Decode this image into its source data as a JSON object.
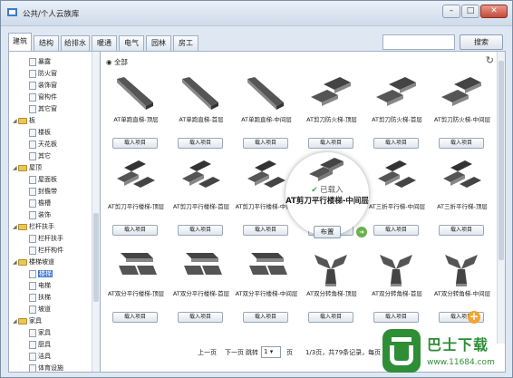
{
  "window": {
    "title": "公共/个人云族库",
    "min": "–",
    "max": "□",
    "close": "✕"
  },
  "tabs": [
    "建筑",
    "结构",
    "给排水",
    "暖通",
    "电气",
    "园林",
    "房工"
  ],
  "active_tab": 0,
  "search": {
    "value": "",
    "button": "搜索"
  },
  "tree": [
    {
      "label": "暴露",
      "level": 2,
      "icon": "doc"
    },
    {
      "label": "防火窗",
      "level": 2,
      "icon": "doc"
    },
    {
      "label": "装饰窗",
      "level": 2,
      "icon": "doc"
    },
    {
      "label": "窗构件",
      "level": 2,
      "icon": "doc"
    },
    {
      "label": "其它窗",
      "level": 2,
      "icon": "doc"
    },
    {
      "label": "板",
      "level": 1,
      "icon": "folder"
    },
    {
      "label": "楼板",
      "level": 2,
      "icon": "doc"
    },
    {
      "label": "天花板",
      "level": 2,
      "icon": "doc"
    },
    {
      "label": "其它",
      "level": 2,
      "icon": "doc"
    },
    {
      "label": "屋顶",
      "level": 1,
      "icon": "folder"
    },
    {
      "label": "屋面板",
      "level": 2,
      "icon": "doc"
    },
    {
      "label": "封檐带",
      "level": 2,
      "icon": "doc"
    },
    {
      "label": "檐槽",
      "level": 2,
      "icon": "doc"
    },
    {
      "label": "装饰",
      "level": 2,
      "icon": "doc"
    },
    {
      "label": "栏杆扶手",
      "level": 1,
      "icon": "folder"
    },
    {
      "label": "栏杆扶手",
      "level": 2,
      "icon": "doc"
    },
    {
      "label": "栏杆构件",
      "level": 2,
      "icon": "doc"
    },
    {
      "label": "楼梯坡道",
      "level": 1,
      "icon": "folder"
    },
    {
      "label": "楼梯",
      "level": 2,
      "icon": "doc",
      "selected": true
    },
    {
      "label": "电梯",
      "level": 2,
      "icon": "doc"
    },
    {
      "label": "扶梯",
      "level": 2,
      "icon": "doc"
    },
    {
      "label": "坡道",
      "level": 2,
      "icon": "doc"
    },
    {
      "label": "家具",
      "level": 1,
      "icon": "folder"
    },
    {
      "label": "家具",
      "level": 2,
      "icon": "doc"
    },
    {
      "label": "厨具",
      "level": 2,
      "icon": "doc"
    },
    {
      "label": "洁具",
      "level": 2,
      "icon": "doc"
    },
    {
      "label": "体育设施",
      "level": 2,
      "icon": "doc"
    }
  ],
  "scope_label": "全部",
  "load_label": "载入项目",
  "items": [
    {
      "name": "AT单跑直梯-顶层",
      "shape": "straight"
    },
    {
      "name": "AT单跑直梯-首层",
      "shape": "straight"
    },
    {
      "name": "AT单跑直梯-中间层",
      "shape": "straight"
    },
    {
      "name": "AT剪刀防火梯-顶层",
      "shape": "scissor"
    },
    {
      "name": "AT剪刀防火梯-首层",
      "shape": "scissor"
    },
    {
      "name": "AT剪刀防火梯-中间层",
      "shape": "scissor"
    },
    {
      "name": "AT剪刀平行楼梯-顶层",
      "shape": "parallel"
    },
    {
      "name": "AT剪刀平行楼梯-首层",
      "shape": "parallel"
    },
    {
      "name": "AT剪刀平行楼梯-中间层",
      "shape": "parallel"
    },
    {
      "name": "AT剪刀平行楼梯-首层",
      "shape": "parallel"
    },
    {
      "name": "AT三折平行梯-中间层",
      "shape": "parallel"
    },
    {
      "name": "AT三折平行梯-顶层",
      "shape": "parallel"
    },
    {
      "name": "AT双分平行楼梯-顶层",
      "shape": "double"
    },
    {
      "name": "AT双分平行楼梯-首层",
      "shape": "double"
    },
    {
      "name": "AT双分平行楼梯-中间层",
      "shape": "double"
    },
    {
      "name": "AT双分转角梯-顶层",
      "shape": "corner"
    },
    {
      "name": "AT双分转角梯-首层",
      "shape": "corner"
    },
    {
      "name": "AT双分转角梯-中间层",
      "shape": "corner"
    }
  ],
  "popup": {
    "status": "已载入",
    "name": "AT剪刀平行楼梯-中间层",
    "button": "布置"
  },
  "pager": {
    "prev": "上一页",
    "next": "下一页",
    "jump": "跳转",
    "page": "1",
    "page_unit": "页",
    "summary": "1/3页，共79条记录，每页"
  },
  "watermark": {
    "brand": "巴士下载",
    "url": "www.11684.com"
  }
}
